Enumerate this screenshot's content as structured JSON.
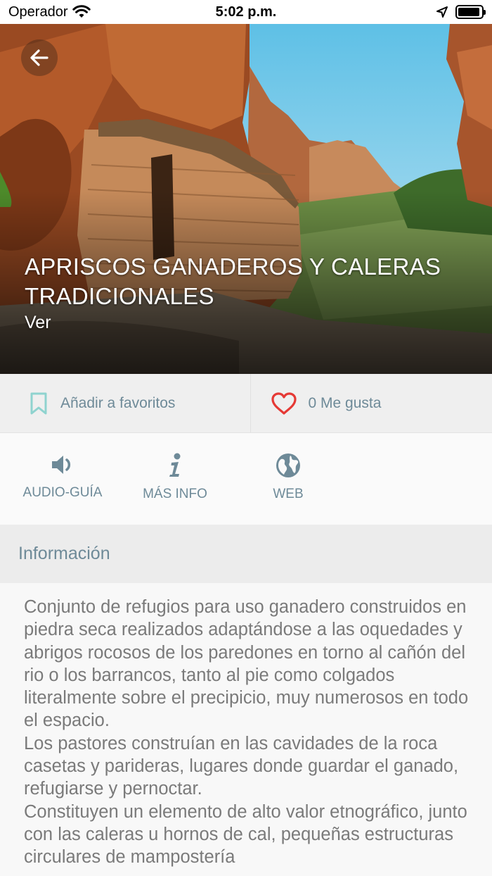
{
  "status_bar": {
    "carrier": "Operador",
    "time": "5:02 p.m.",
    "battery_level": 0.95
  },
  "hero": {
    "title_line1": "APRISCOS GANADEROS Y CALERAS",
    "title_line2": "TRADICIONALES",
    "subtitle": "Ver",
    "back_icon": "arrow-left-icon"
  },
  "actions": {
    "favorites_label": "Añadir a favoritos",
    "favorites_icon": "bookmark-icon",
    "likes_label": "0 Me gusta",
    "likes_icon": "heart-icon"
  },
  "quick_buttons": [
    {
      "label": "AUDIO-GUÍA",
      "icon": "speaker-icon"
    },
    {
      "label": "MÁS INFO",
      "icon": "info-icon"
    },
    {
      "label": "WEB",
      "icon": "globe-icon"
    }
  ],
  "info": {
    "header": "Información",
    "paragraphs": [
      "Conjunto de refugios para uso ganadero construidos en piedra seca realizados adaptándose a las oquedades y abrigos rocosos de los paredones en torno al cañón del rio o los barrancos, tanto al pie como colgados literalmente sobre el precipicio, muy numerosos en todo el espacio.",
      "Los pastores construían en las cavidades de la roca casetas y parideras, lugares donde guardar el ganado, refugiarse y pernoctar.",
      "Constituyen un elemento de alto valor etnográfico, junto con las caleras u hornos de cal, pequeñas estructuras circulares de mampostería"
    ]
  },
  "colors": {
    "accent": "#6e8a98",
    "bookmark": "#8fd3cf",
    "heart": "#e53935"
  }
}
